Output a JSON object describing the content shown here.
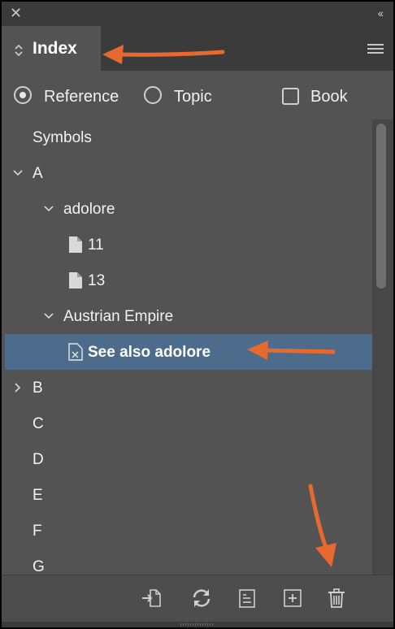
{
  "panel": {
    "close_glyph": "✕",
    "collapse_glyph": "‹‹",
    "tab_title": "Index",
    "options": [
      {
        "label": "Reference",
        "selected": true
      },
      {
        "label": "Topic",
        "selected": false
      }
    ],
    "book": {
      "label": "Book",
      "checked": false
    }
  },
  "tree": [
    {
      "label": "Symbols",
      "level": 0,
      "expander": "none",
      "icon": "none"
    },
    {
      "label": "A",
      "level": 0,
      "expander": "expanded",
      "icon": "none"
    },
    {
      "label": "adolore",
      "level": 1,
      "expander": "expanded",
      "icon": "none"
    },
    {
      "label": "11",
      "level": 2,
      "expander": "none",
      "icon": "page-icon"
    },
    {
      "label": "13",
      "level": 2,
      "expander": "none",
      "icon": "page-icon"
    },
    {
      "label": "Austrian Empire",
      "level": 1,
      "expander": "expanded",
      "icon": "none"
    },
    {
      "label": "See also adolore",
      "level": 2,
      "expander": "none",
      "icon": "cross-reference-icon",
      "selected": true
    },
    {
      "label": "B",
      "level": 0,
      "expander": "collapsed",
      "icon": "none"
    },
    {
      "label": "C",
      "level": 0,
      "expander": "none",
      "icon": "none"
    },
    {
      "label": "D",
      "level": 0,
      "expander": "none",
      "icon": "none"
    },
    {
      "label": "E",
      "level": 0,
      "expander": "none",
      "icon": "none"
    },
    {
      "label": "F",
      "level": 0,
      "expander": "none",
      "icon": "none"
    },
    {
      "label": "G",
      "level": 0,
      "expander": "none",
      "icon": "none"
    }
  ],
  "toolbar": [
    {
      "name": "go-to-selected-marker-icon"
    },
    {
      "name": "update-preview-icon"
    },
    {
      "name": "generate-index-icon"
    },
    {
      "name": "new-index-entry-icon"
    },
    {
      "name": "delete-entry-icon"
    }
  ],
  "colors": {
    "panel_bg": "#535353",
    "selection": "#4d6b8b",
    "annotation_arrow": "#e8692f"
  }
}
